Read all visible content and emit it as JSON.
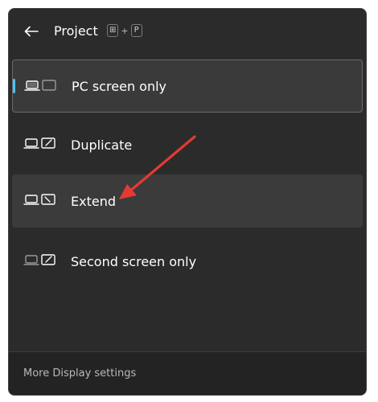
{
  "header": {
    "title": "Project",
    "shortcut": {
      "key1": "⊞",
      "plus": "+",
      "key2": "P"
    }
  },
  "options": [
    {
      "label": "PC screen only",
      "selected": true
    },
    {
      "label": "Duplicate",
      "selected": false
    },
    {
      "label": "Extend",
      "selected": false
    },
    {
      "label": "Second screen only",
      "selected": false
    }
  ],
  "footer": {
    "link": "More Display settings"
  },
  "colors": {
    "accent": "#4cc2ff",
    "panel": "#2b2b2b",
    "annotation_arrow": "#e53935"
  }
}
